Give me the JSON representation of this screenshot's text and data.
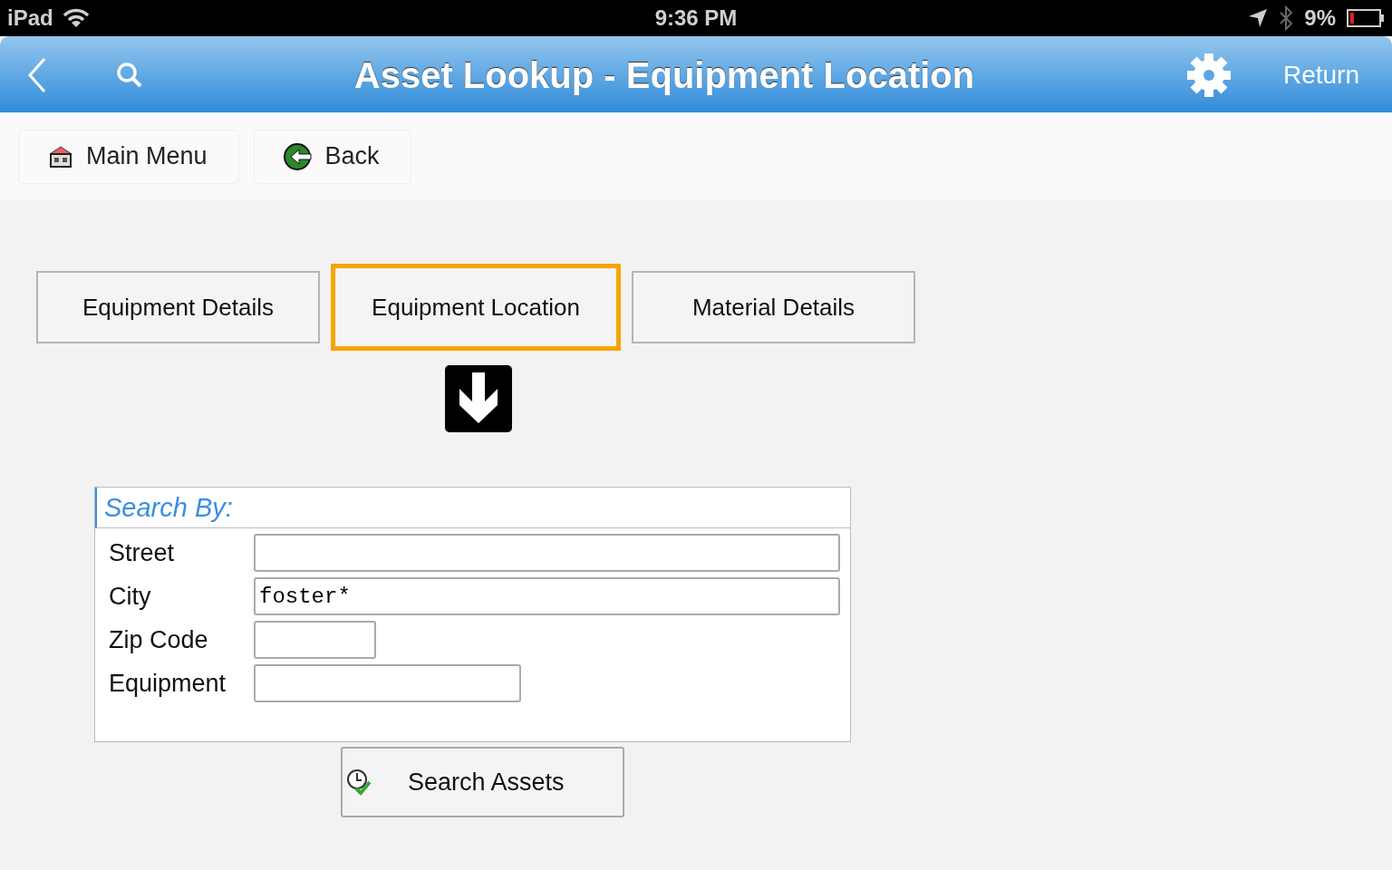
{
  "status_bar": {
    "device": "iPad",
    "time": "9:36 PM",
    "battery": "9%"
  },
  "nav_bar": {
    "title": "Asset Lookup - Equipment Location",
    "return_label": "Return"
  },
  "toolbar": [
    {
      "label": "Main Menu",
      "kind": "home"
    },
    {
      "label": "Back",
      "kind": "back"
    }
  ],
  "tabs": [
    {
      "label": "Equipment Details",
      "selected": false
    },
    {
      "label": "Equipment Location",
      "selected": true
    },
    {
      "label": "Material Details",
      "selected": false
    }
  ],
  "search_form": {
    "legend": "Search By:",
    "fields": [
      {
        "label": "Street",
        "kind": "wide"
      },
      {
        "label": "City",
        "value": "foster*",
        "kind": "wide"
      },
      {
        "label": "Zip Code",
        "kind": "short"
      },
      {
        "label": "Equipment",
        "kind": "medium"
      }
    ]
  },
  "search_button": "Search Assets"
}
